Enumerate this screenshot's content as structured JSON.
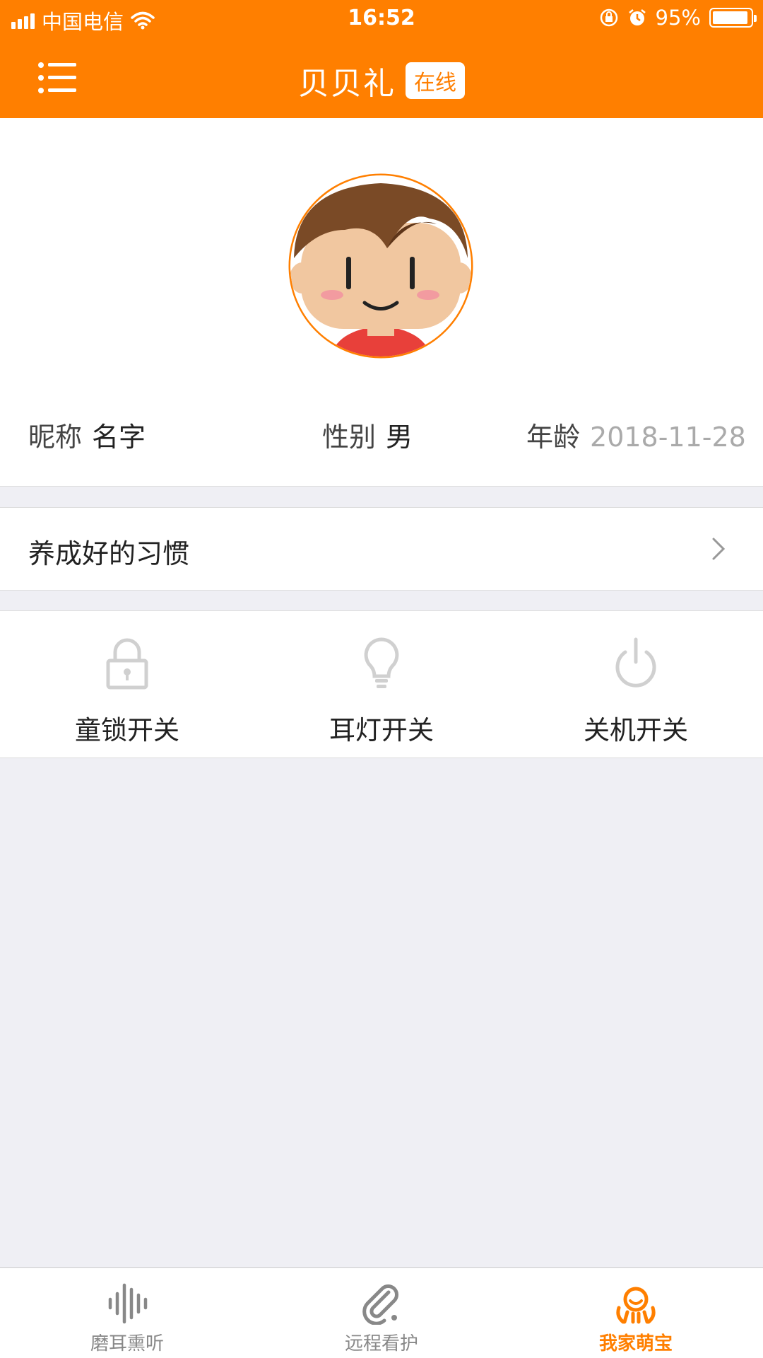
{
  "status_bar": {
    "carrier": "中国电信",
    "time": "16:52",
    "battery_percent": "95%",
    "battery_level": 0.95
  },
  "nav": {
    "title": "贝贝礼",
    "status_badge": "在线"
  },
  "profile": {
    "nickname_label": "昵称",
    "nickname_value": "名字",
    "gender_label": "性别",
    "gender_value": "男",
    "age_label": "年龄",
    "age_value": "2018-11-28"
  },
  "habit": {
    "label": "养成好的习惯"
  },
  "switches": [
    {
      "label": "童锁开关",
      "icon": "lock-icon"
    },
    {
      "label": "耳灯开关",
      "icon": "lightbulb-icon"
    },
    {
      "label": "关机开关",
      "icon": "power-icon"
    }
  ],
  "tabs": [
    {
      "label": "磨耳熏听",
      "icon": "audio-wave-icon",
      "active": false
    },
    {
      "label": "远程看护",
      "icon": "paperclip-icon",
      "active": false
    },
    {
      "label": "我家萌宝",
      "icon": "baby-icon",
      "active": true
    }
  ],
  "colors": {
    "accent": "#ff7f00",
    "inactive_icon": "#d0d0d0",
    "background": "#efeff4"
  }
}
